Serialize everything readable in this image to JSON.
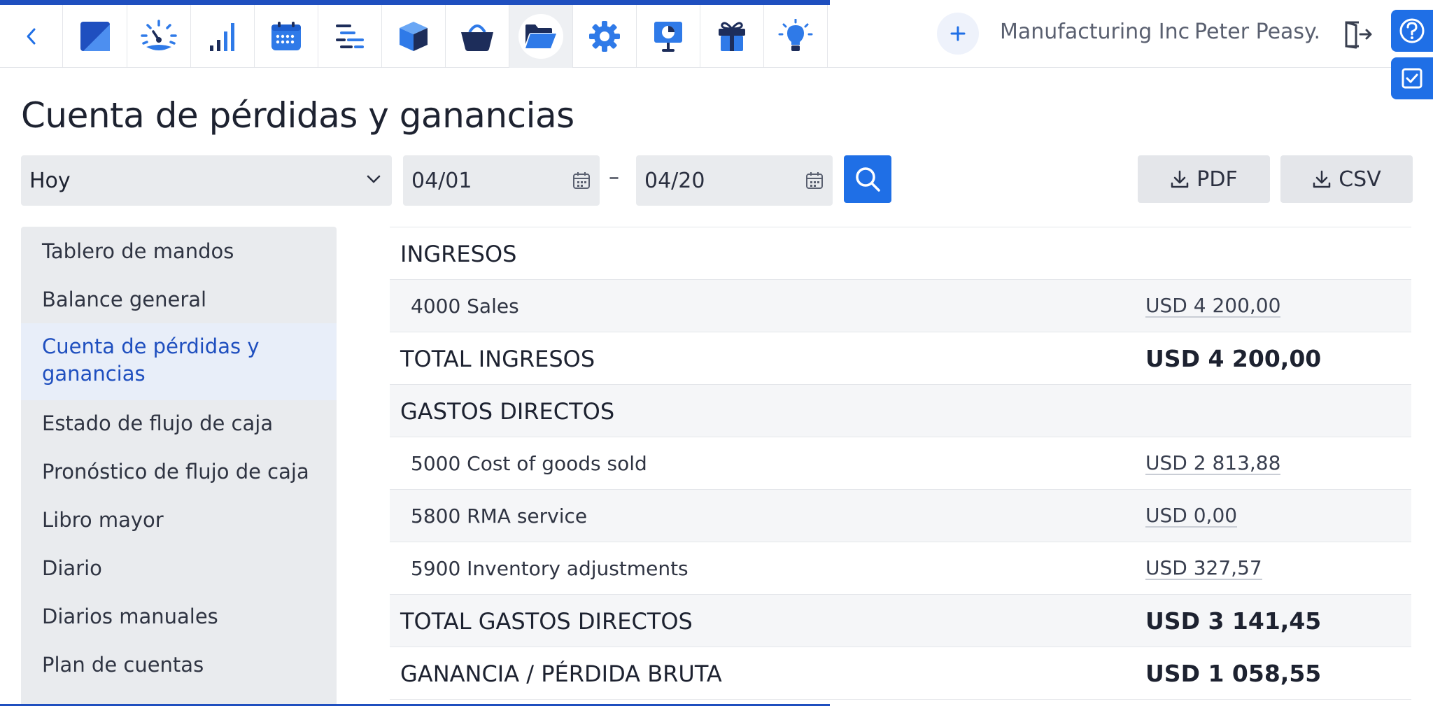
{
  "header": {
    "company": "Manufacturing Inc",
    "user": "Peter Peasy.",
    "modules": [
      {
        "name": "logo-icon"
      },
      {
        "name": "dashboard-gauge-icon"
      },
      {
        "name": "signal-bars-icon"
      },
      {
        "name": "calendar-icon"
      },
      {
        "name": "list-tree-icon"
      },
      {
        "name": "box-icon"
      },
      {
        "name": "basket-icon"
      },
      {
        "name": "folder-open-icon"
      },
      {
        "name": "gear-icon"
      },
      {
        "name": "presentation-chart-icon"
      },
      {
        "name": "gift-icon"
      },
      {
        "name": "lightbulb-icon"
      }
    ],
    "active_module": "folder-open-icon",
    "accent_color": "#1f6fe6",
    "brand_dark": "#1f4fbf"
  },
  "page": {
    "title": "Cuenta de pérdidas y ganancias"
  },
  "filters": {
    "period": "Hoy",
    "date_from": "04/01",
    "date_to": "04/20",
    "separator": "–",
    "pdf_label": "PDF",
    "csv_label": "CSV"
  },
  "sidebar": {
    "items": [
      {
        "label": "Tablero de mandos"
      },
      {
        "label": "Balance general"
      },
      {
        "label": "Cuenta de pérdidas y ganancias",
        "active": true
      },
      {
        "label": "Estado de flujo de caja"
      },
      {
        "label": "Pronóstico de flujo de caja"
      },
      {
        "label": "Libro mayor"
      },
      {
        "label": "Diario"
      },
      {
        "label": "Diarios manuales"
      },
      {
        "label": "Plan de cuentas"
      }
    ]
  },
  "report": {
    "rows": [
      {
        "type": "section",
        "label": "INGRESOS",
        "amount": ""
      },
      {
        "type": "item",
        "label": "4000 Sales",
        "amount": "USD 4 200,00"
      },
      {
        "type": "total",
        "label": "TOTAL INGRESOS",
        "amount": "USD 4 200,00"
      },
      {
        "type": "section",
        "label": "GASTOS DIRECTOS",
        "amount": ""
      },
      {
        "type": "item",
        "label": "5000 Cost of goods sold",
        "amount": "USD 2 813,88"
      },
      {
        "type": "item",
        "label": "5800 RMA service",
        "amount": "USD 0,00"
      },
      {
        "type": "item",
        "label": "5900 Inventory adjustments",
        "amount": "USD 327,57"
      },
      {
        "type": "total",
        "label": "TOTAL GASTOS DIRECTOS",
        "amount": "USD 3 141,45"
      },
      {
        "type": "total",
        "label": "GANANCIA / PÉRDIDA BRUTA",
        "amount": "USD 1 058,55"
      }
    ]
  }
}
